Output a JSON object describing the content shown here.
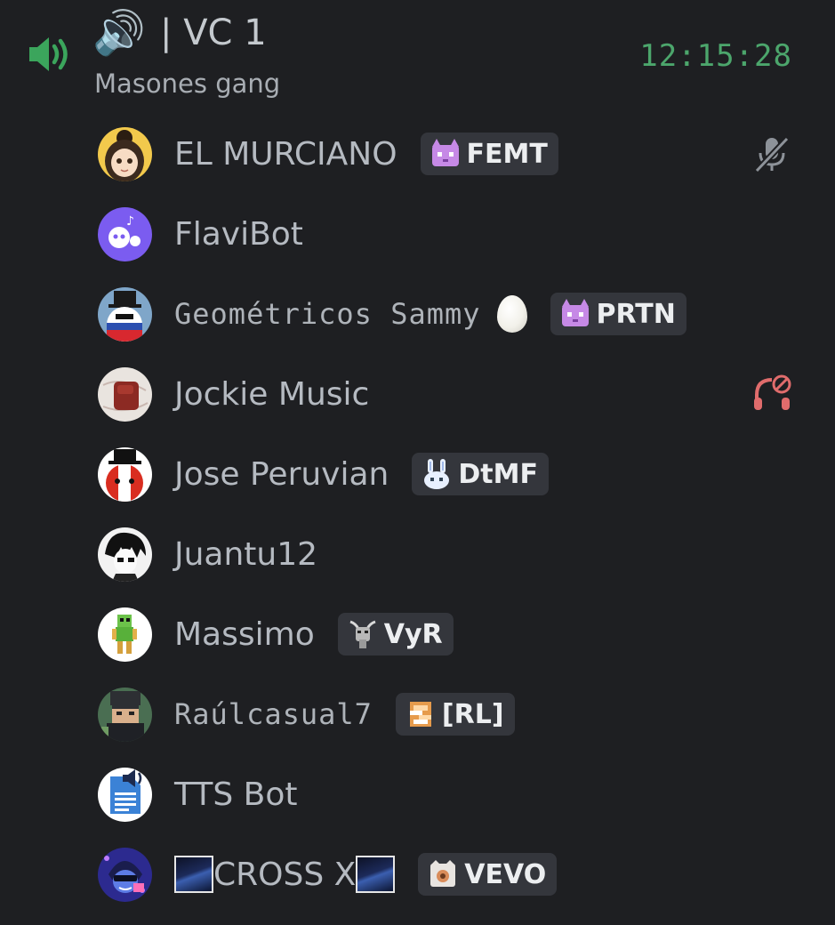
{
  "channel": {
    "emoji": "🔊",
    "title": "| VC 1",
    "status": "Masones gang",
    "timer": "12:15:28"
  },
  "members": [
    {
      "name": "EL MURCIANO",
      "tag": "FEMT",
      "tag_icon": "purple-cat-icon",
      "status_icon": "mic-muted-icon",
      "avatar": "anime-girl-avatar"
    },
    {
      "name": "FlaviBot",
      "avatar": "purple-bot-avatar"
    },
    {
      "name": "Geométricos Sammy",
      "pixel_font": true,
      "extra_emoji": "egg-emoji",
      "tag": "PRTN",
      "tag_icon": "purple-cat-icon",
      "avatar": "countryball-avatar"
    },
    {
      "name": "Jockie Music",
      "status_icon": "headphones-deafened-icon",
      "avatar": "jockie-avatar"
    },
    {
      "name": "Jose Peruvian",
      "tag": "DtMF",
      "tag_icon": "white-bunny-icon",
      "avatar": "peru-ball-avatar"
    },
    {
      "name": "Juantu12",
      "avatar": "manga-avatar"
    },
    {
      "name": "Massimo",
      "tag": "VyR",
      "tag_icon": "goat-icon",
      "avatar": "green-character-avatar"
    },
    {
      "name": "Raúlcasual7",
      "pixel_font": true,
      "tag": "[RL]",
      "tag_icon": "orange-gear-icon",
      "avatar": "minecraft-avatar"
    },
    {
      "name": "TTS Bot",
      "avatar": "tts-doc-avatar"
    },
    {
      "name": "CROSS X",
      "star_boxes": true,
      "tag": "VEVO",
      "tag_icon": "vevo-icon",
      "avatar": "blue-gamer-avatar"
    }
  ],
  "colors": {
    "background": "#1e1f22",
    "speaking_green": "#3ba55c",
    "timer_green": "#4ca66c",
    "tag_bg": "#34363c",
    "deafened_red": "#e06c6c"
  }
}
